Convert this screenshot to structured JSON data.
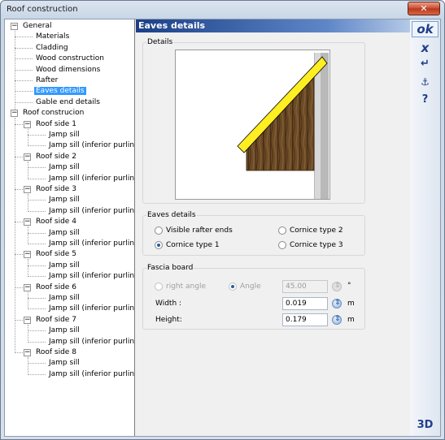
{
  "window": {
    "title": "Roof construction",
    "close_label": "✕"
  },
  "tree": {
    "general": "General",
    "general_children": [
      "Materials",
      "Cladding",
      "Wood construction",
      "Wood dimensions",
      "Rafter",
      "Eaves details",
      "Gable end details"
    ],
    "selected": "Eaves details",
    "roof_construction": "Roof construcion",
    "roof_sides": [
      {
        "label": "Roof side 1",
        "children": [
          "Jamp sill",
          "Jamp sill (inferior purlin)"
        ]
      },
      {
        "label": "Roof side 2",
        "children": [
          "Jamp sill",
          "Jamp sill (inferior purlin)"
        ]
      },
      {
        "label": "Roof side 3",
        "children": [
          "Jamp sill",
          "Jamp sill (inferior purlin)"
        ]
      },
      {
        "label": "Roof side 4",
        "children": [
          "Jamp sill",
          "Jamp sill (inferior purlin)"
        ]
      },
      {
        "label": "Roof side 5",
        "children": [
          "Jamp sill",
          "Jamp sill (inferior purlin)"
        ]
      },
      {
        "label": "Roof side 6",
        "children": [
          "Jamp sill",
          "Jamp sill (inferior purlin)"
        ]
      },
      {
        "label": "Roof side 7",
        "children": [
          "Jamp sill",
          "Jamp sill (inferior purlin)"
        ]
      },
      {
        "label": "Roof side 8",
        "children": [
          "Jamp sill",
          "Jamp sill (inferior purlin)"
        ]
      }
    ]
  },
  "panel": {
    "header": "Eaves details",
    "details_group": "Details",
    "eaves_group": "Eaves details",
    "options": {
      "visible_rafter_ends": "Visible rafter ends",
      "cornice_type_1": "Cornice type 1",
      "cornice_type_2": "Cornice type 2",
      "cornice_type_3": "Cornice type 3",
      "selected": "Cornice type 1"
    },
    "fascia": {
      "group": "Fascia board",
      "right_angle": "right angle",
      "angle": "Angle",
      "angle_value": "45.00",
      "angle_unit": "°",
      "width_label": "Width :",
      "width_value": "0.019",
      "height_label": "Height:",
      "height_value": "0.179",
      "unit": "m"
    }
  },
  "toolbar": {
    "ok": "ok",
    "cancel": "x",
    "enter": "↵",
    "anchor": "⚓",
    "help": "?",
    "view3d": "3D"
  },
  "colors": {
    "header_start": "#1b3f86",
    "selection": "#3399ff",
    "fascia_yellow": "#ffee22",
    "wood": "#6b4a26"
  }
}
